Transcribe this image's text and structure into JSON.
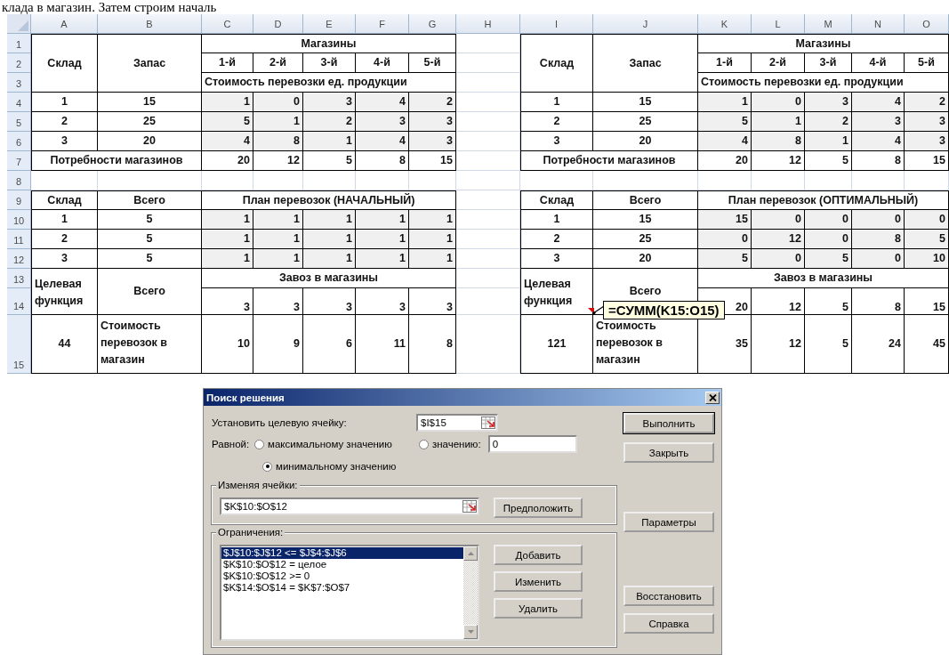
{
  "page_text": "клада в магазин. Затем строим началь",
  "sheet": {
    "column_headers": [
      "A",
      "B",
      "C",
      "D",
      "E",
      "F",
      "G",
      "H",
      "I",
      "J",
      "K",
      "L",
      "M",
      "N",
      "O"
    ],
    "row_headers": [
      "1",
      "2",
      "3",
      "4",
      "5",
      "6",
      "7",
      "8",
      "9",
      "10",
      "11",
      "12",
      "13",
      "14",
      "15"
    ],
    "tables": [
      {
        "warehouse_label": "Склад",
        "stock_label": "Запас",
        "shops_label": "Магазины",
        "shops": [
          "1-й",
          "2-й",
          "3-й",
          "4-й",
          "5-й"
        ],
        "cost_label": "Стоимость перевозки ед. продукции",
        "cost_rows": [
          {
            "warehouse": "1",
            "stock": "15",
            "costs": [
              "1",
              "0",
              "3",
              "4",
              "2"
            ]
          },
          {
            "warehouse": "2",
            "stock": "25",
            "costs": [
              "5",
              "1",
              "2",
              "3",
              "3"
            ]
          },
          {
            "warehouse": "3",
            "stock": "20",
            "costs": [
              "4",
              "8",
              "1",
              "4",
              "3"
            ]
          }
        ],
        "demand_label": "Потребности магазинов",
        "demand": [
          "20",
          "12",
          "5",
          "8",
          "15"
        ],
        "plan_warehouse_label": "Склад",
        "plan_total_label": "Всего",
        "plan_label": "План перевозок (НАЧАЛЬНЫЙ)",
        "plan_rows": [
          {
            "warehouse": "1",
            "total": "5",
            "amounts": [
              "1",
              "1",
              "1",
              "1",
              "1"
            ]
          },
          {
            "warehouse": "2",
            "total": "5",
            "amounts": [
              "1",
              "1",
              "1",
              "1",
              "1"
            ]
          },
          {
            "warehouse": "3",
            "total": "5",
            "amounts": [
              "1",
              "1",
              "1",
              "1",
              "1"
            ]
          }
        ],
        "objective_label": "Целевая функция",
        "delivery_total_label": "Всего",
        "delivery_label": "Завоз в магазины",
        "deliveries": [
          "3",
          "3",
          "3",
          "3",
          "3"
        ],
        "objective_value": "44",
        "shop_cost_label": "Стоимость перевозок в магазин",
        "shop_costs": [
          "10",
          "9",
          "6",
          "11",
          "8"
        ]
      },
      {
        "warehouse_label": "Склад",
        "stock_label": "Запас",
        "shops_label": "Магазины",
        "shops": [
          "1-й",
          "2-й",
          "3-й",
          "4-й",
          "5-й"
        ],
        "cost_label": "Стоимость перевозки ед. продукции",
        "cost_rows": [
          {
            "warehouse": "1",
            "stock": "15",
            "costs": [
              "1",
              "0",
              "3",
              "4",
              "2"
            ]
          },
          {
            "warehouse": "2",
            "stock": "25",
            "costs": [
              "5",
              "1",
              "2",
              "3",
              "3"
            ]
          },
          {
            "warehouse": "3",
            "stock": "20",
            "costs": [
              "4",
              "8",
              "1",
              "4",
              "3"
            ]
          }
        ],
        "demand_label": "Потребности магазинов",
        "demand": [
          "20",
          "12",
          "5",
          "8",
          "15"
        ],
        "plan_warehouse_label": "Склад",
        "plan_total_label": "Всего",
        "plan_label": "План перевозок (ОПТИМАЛЬНЫЙ)",
        "plan_rows": [
          {
            "warehouse": "1",
            "total": "15",
            "amounts": [
              "15",
              "0",
              "0",
              "0",
              "0"
            ]
          },
          {
            "warehouse": "2",
            "total": "25",
            "amounts": [
              "0",
              "12",
              "0",
              "8",
              "5"
            ]
          },
          {
            "warehouse": "3",
            "total": "20",
            "amounts": [
              "5",
              "0",
              "5",
              "0",
              "10"
            ]
          }
        ],
        "objective_label": "Целевая функция",
        "delivery_total_label": "Всего",
        "delivery_label": "Завоз в магазины",
        "deliveries": [
          "20",
          "12",
          "5",
          "8",
          "15"
        ],
        "objective_value": "121",
        "shop_cost_label": "Стоимость перевозок в магазин",
        "shop_costs": [
          "35",
          "12",
          "5",
          "24",
          "45"
        ],
        "formula_tip": "=СУММ(K15:O15)"
      }
    ]
  },
  "dialog": {
    "title": "Поиск решения",
    "target_label": "Установить целевую ячейку:",
    "target_value": "$I$15",
    "equal_label": "Равной:",
    "options": [
      {
        "label": "максимальному значению",
        "selected": false
      },
      {
        "label": "значению:",
        "selected": false
      },
      {
        "label": "минимальному значению",
        "selected": true
      }
    ],
    "value_field": "0",
    "changing_label": "Изменяя ячейки:",
    "changing_value": "$K$10:$O$12",
    "guess_button": "Предположить",
    "constraints_label": "Ограничения:",
    "constraints": [
      {
        "text": "$J$10:$J$12 <= $J$4:$J$6",
        "selected": true
      },
      {
        "text": "$K$10:$O$12 = целое",
        "selected": false
      },
      {
        "text": "$K$10:$O$12 >= 0",
        "selected": false
      },
      {
        "text": "$K$14:$O$14 = $K$7:$O$7",
        "selected": false
      }
    ],
    "constraint_buttons": [
      "Добавить",
      "Изменить",
      "Удалить"
    ],
    "side_buttons": [
      "Выполнить",
      "Закрыть",
      "Параметры",
      "Восстановить",
      "Справка"
    ]
  }
}
